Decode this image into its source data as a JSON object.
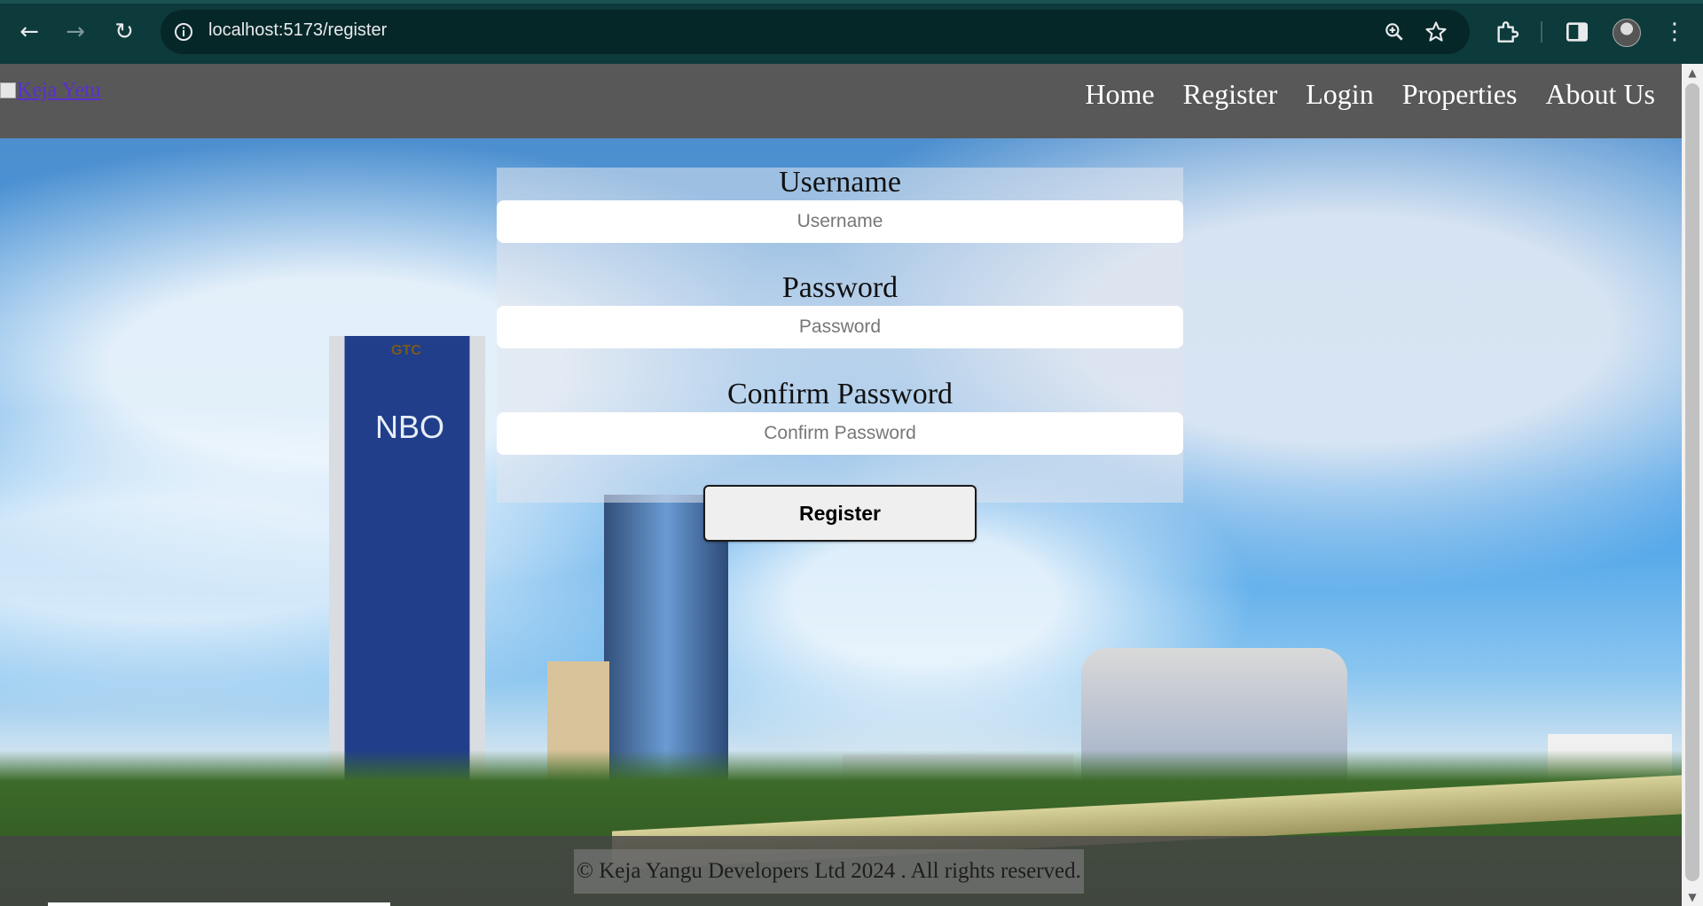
{
  "browser": {
    "url": "localhost:5173/register",
    "back_icon": "←",
    "forward_icon": "→",
    "reload_icon": "↻",
    "menu_icon": "⋮"
  },
  "site": {
    "logo_alt": "Keja Yetu",
    "nav": [
      {
        "label": "Home"
      },
      {
        "label": "Register"
      },
      {
        "label": "Login"
      },
      {
        "label": "Properties"
      },
      {
        "label": "About Us"
      }
    ]
  },
  "form": {
    "username_label": "Username",
    "username_placeholder": "Username",
    "password_label": "Password",
    "password_placeholder": "Password",
    "confirm_label": "Confirm Password",
    "confirm_placeholder": "Confirm Password",
    "submit_label": "Register"
  },
  "hero": {
    "tower_text": "NBO",
    "tower_sign": "GTC"
  },
  "footer": {
    "text": "© Keja Yangu Developers Ltd 2024 . All rights reserved."
  },
  "colors": {
    "chrome_bg": "#0d3a3a",
    "header_bg": "#585858",
    "link_purple": "#5a2fd0"
  }
}
